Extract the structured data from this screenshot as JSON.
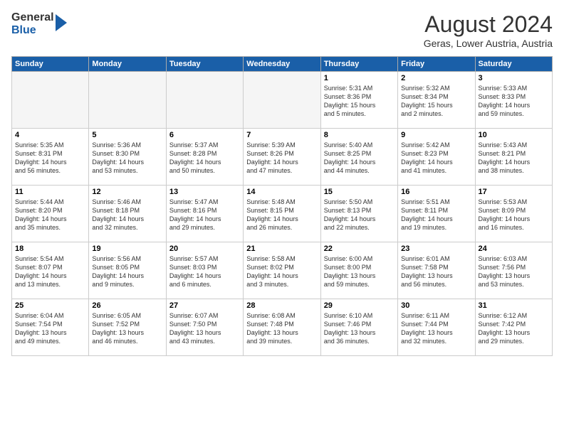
{
  "header": {
    "logo_line1": "General",
    "logo_line2": "Blue",
    "month_year": "August 2024",
    "location": "Geras, Lower Austria, Austria"
  },
  "weekdays": [
    "Sunday",
    "Monday",
    "Tuesday",
    "Wednesday",
    "Thursday",
    "Friday",
    "Saturday"
  ],
  "weeks": [
    [
      {
        "day": "",
        "info": ""
      },
      {
        "day": "",
        "info": ""
      },
      {
        "day": "",
        "info": ""
      },
      {
        "day": "",
        "info": ""
      },
      {
        "day": "1",
        "info": "Sunrise: 5:31 AM\nSunset: 8:36 PM\nDaylight: 15 hours\nand 5 minutes."
      },
      {
        "day": "2",
        "info": "Sunrise: 5:32 AM\nSunset: 8:34 PM\nDaylight: 15 hours\nand 2 minutes."
      },
      {
        "day": "3",
        "info": "Sunrise: 5:33 AM\nSunset: 8:33 PM\nDaylight: 14 hours\nand 59 minutes."
      }
    ],
    [
      {
        "day": "4",
        "info": "Sunrise: 5:35 AM\nSunset: 8:31 PM\nDaylight: 14 hours\nand 56 minutes."
      },
      {
        "day": "5",
        "info": "Sunrise: 5:36 AM\nSunset: 8:30 PM\nDaylight: 14 hours\nand 53 minutes."
      },
      {
        "day": "6",
        "info": "Sunrise: 5:37 AM\nSunset: 8:28 PM\nDaylight: 14 hours\nand 50 minutes."
      },
      {
        "day": "7",
        "info": "Sunrise: 5:39 AM\nSunset: 8:26 PM\nDaylight: 14 hours\nand 47 minutes."
      },
      {
        "day": "8",
        "info": "Sunrise: 5:40 AM\nSunset: 8:25 PM\nDaylight: 14 hours\nand 44 minutes."
      },
      {
        "day": "9",
        "info": "Sunrise: 5:42 AM\nSunset: 8:23 PM\nDaylight: 14 hours\nand 41 minutes."
      },
      {
        "day": "10",
        "info": "Sunrise: 5:43 AM\nSunset: 8:21 PM\nDaylight: 14 hours\nand 38 minutes."
      }
    ],
    [
      {
        "day": "11",
        "info": "Sunrise: 5:44 AM\nSunset: 8:20 PM\nDaylight: 14 hours\nand 35 minutes."
      },
      {
        "day": "12",
        "info": "Sunrise: 5:46 AM\nSunset: 8:18 PM\nDaylight: 14 hours\nand 32 minutes."
      },
      {
        "day": "13",
        "info": "Sunrise: 5:47 AM\nSunset: 8:16 PM\nDaylight: 14 hours\nand 29 minutes."
      },
      {
        "day": "14",
        "info": "Sunrise: 5:48 AM\nSunset: 8:15 PM\nDaylight: 14 hours\nand 26 minutes."
      },
      {
        "day": "15",
        "info": "Sunrise: 5:50 AM\nSunset: 8:13 PM\nDaylight: 14 hours\nand 22 minutes."
      },
      {
        "day": "16",
        "info": "Sunrise: 5:51 AM\nSunset: 8:11 PM\nDaylight: 14 hours\nand 19 minutes."
      },
      {
        "day": "17",
        "info": "Sunrise: 5:53 AM\nSunset: 8:09 PM\nDaylight: 14 hours\nand 16 minutes."
      }
    ],
    [
      {
        "day": "18",
        "info": "Sunrise: 5:54 AM\nSunset: 8:07 PM\nDaylight: 14 hours\nand 13 minutes."
      },
      {
        "day": "19",
        "info": "Sunrise: 5:56 AM\nSunset: 8:05 PM\nDaylight: 14 hours\nand 9 minutes."
      },
      {
        "day": "20",
        "info": "Sunrise: 5:57 AM\nSunset: 8:03 PM\nDaylight: 14 hours\nand 6 minutes."
      },
      {
        "day": "21",
        "info": "Sunrise: 5:58 AM\nSunset: 8:02 PM\nDaylight: 14 hours\nand 3 minutes."
      },
      {
        "day": "22",
        "info": "Sunrise: 6:00 AM\nSunset: 8:00 PM\nDaylight: 13 hours\nand 59 minutes."
      },
      {
        "day": "23",
        "info": "Sunrise: 6:01 AM\nSunset: 7:58 PM\nDaylight: 13 hours\nand 56 minutes."
      },
      {
        "day": "24",
        "info": "Sunrise: 6:03 AM\nSunset: 7:56 PM\nDaylight: 13 hours\nand 53 minutes."
      }
    ],
    [
      {
        "day": "25",
        "info": "Sunrise: 6:04 AM\nSunset: 7:54 PM\nDaylight: 13 hours\nand 49 minutes."
      },
      {
        "day": "26",
        "info": "Sunrise: 6:05 AM\nSunset: 7:52 PM\nDaylight: 13 hours\nand 46 minutes."
      },
      {
        "day": "27",
        "info": "Sunrise: 6:07 AM\nSunset: 7:50 PM\nDaylight: 13 hours\nand 43 minutes."
      },
      {
        "day": "28",
        "info": "Sunrise: 6:08 AM\nSunset: 7:48 PM\nDaylight: 13 hours\nand 39 minutes."
      },
      {
        "day": "29",
        "info": "Sunrise: 6:10 AM\nSunset: 7:46 PM\nDaylight: 13 hours\nand 36 minutes."
      },
      {
        "day": "30",
        "info": "Sunrise: 6:11 AM\nSunset: 7:44 PM\nDaylight: 13 hours\nand 32 minutes."
      },
      {
        "day": "31",
        "info": "Sunrise: 6:12 AM\nSunset: 7:42 PM\nDaylight: 13 hours\nand 29 minutes."
      }
    ]
  ]
}
